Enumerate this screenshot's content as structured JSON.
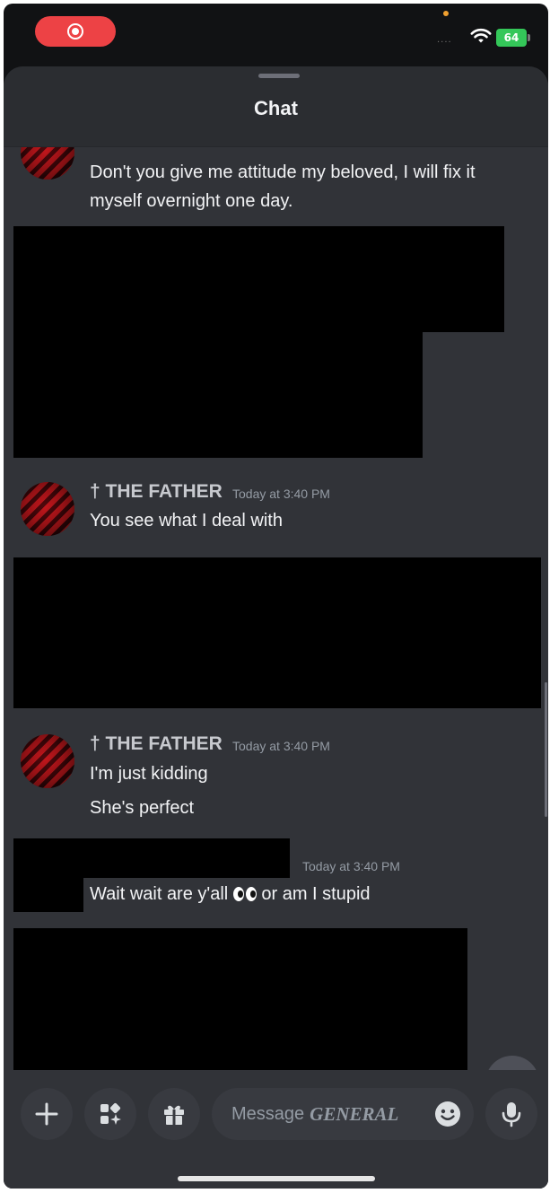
{
  "status_bar": {
    "battery": "64",
    "signal": "····"
  },
  "header": {
    "title": "Chat"
  },
  "messages": [
    {
      "lines": [
        "Don't you give me attitude my beloved, I will fix it",
        "myself overnight one day."
      ]
    },
    {
      "author": "† THE FATHER",
      "time": "Today at 3:40 PM",
      "lines": [
        "You see what I deal with"
      ]
    },
    {
      "author": "† THE FATHER",
      "time": "Today at 3:40 PM",
      "lines": [
        "I'm just kidding",
        "She's perfect"
      ]
    },
    {
      "time": "Today at 3:40 PM",
      "text_before": "Wait wait are y'all",
      "emoji": "eyes",
      "text_after": "or  am I stupid"
    }
  ],
  "composer": {
    "placeholder": "Message",
    "channel": "GENERAL"
  },
  "icons": {
    "close": "close-icon",
    "add": "plus-icon",
    "apps": "apps-icon",
    "gift": "gift-icon",
    "emoji": "emoji-icon",
    "mic": "microphone-icon"
  },
  "colors": {
    "background": "#313338",
    "header": "#2b2d31",
    "input": "#383a40",
    "record": "#ed4245",
    "battery": "#34c759"
  }
}
